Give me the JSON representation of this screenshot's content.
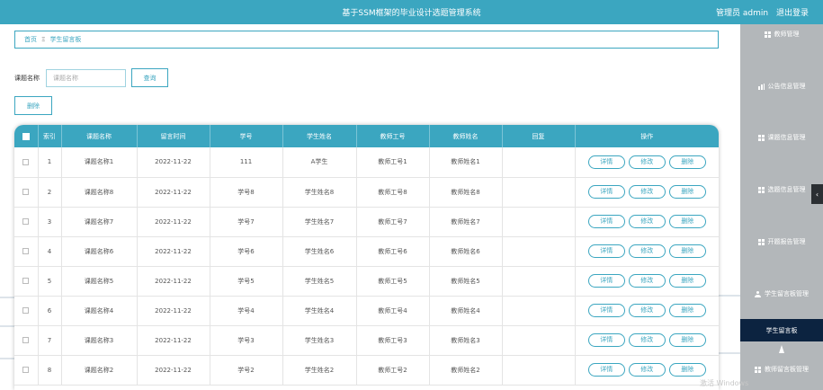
{
  "header": {
    "title": "基于SSM框架的毕业设计选题管理系统",
    "user_label": "管理员 admin",
    "logout_label": "退出登录"
  },
  "sidebar": {
    "items": [
      {
        "label": "教师管理",
        "icon": "grid-icon"
      },
      {
        "label": "公告信息管理",
        "icon": "bar-chart-icon"
      },
      {
        "label": "课题信息管理",
        "icon": "grid-icon"
      },
      {
        "label": "选题信息管理",
        "icon": "grid-icon"
      },
      {
        "label": "开题报告管理",
        "icon": "grid-icon"
      },
      {
        "label": "学生留言板管理",
        "icon": "user-icon"
      },
      {
        "label": "学生留言板",
        "icon": ""
      },
      {
        "label": "教师留言板管理",
        "icon": "grid-icon"
      }
    ],
    "collapse_glyph": "‹"
  },
  "breadcrumb": {
    "home": "首页",
    "separator": "Ξ",
    "current": "学生留言板"
  },
  "search": {
    "label": "课题名称",
    "placeholder": "课题名称",
    "button": "查询"
  },
  "toolbar": {
    "delete_label": "删除"
  },
  "table": {
    "columns": [
      "",
      "索引",
      "课题名称",
      "留言时间",
      "学号",
      "学生姓名",
      "教师工号",
      "教师姓名",
      "回复",
      "操作"
    ],
    "actions": [
      "详情",
      "修改",
      "删除"
    ],
    "rows": [
      {
        "index": "1",
        "topic": "课题名称1",
        "time": "2022-11-22",
        "sid": "111",
        "sname": "A学生",
        "tid": "教师工号1",
        "tname": "教师姓名1",
        "reply": ""
      },
      {
        "index": "2",
        "topic": "课题名称8",
        "time": "2022-11-22",
        "sid": "学号8",
        "sname": "学生姓名8",
        "tid": "教师工号8",
        "tname": "教师姓名8",
        "reply": ""
      },
      {
        "index": "3",
        "topic": "课题名称7",
        "time": "2022-11-22",
        "sid": "学号7",
        "sname": "学生姓名7",
        "tid": "教师工号7",
        "tname": "教师姓名7",
        "reply": ""
      },
      {
        "index": "4",
        "topic": "课题名称6",
        "time": "2022-11-22",
        "sid": "学号6",
        "sname": "学生姓名6",
        "tid": "教师工号6",
        "tname": "教师姓名6",
        "reply": ""
      },
      {
        "index": "5",
        "topic": "课题名称5",
        "time": "2022-11-22",
        "sid": "学号5",
        "sname": "学生姓名5",
        "tid": "教师工号5",
        "tname": "教师姓名5",
        "reply": ""
      },
      {
        "index": "6",
        "topic": "课题名称4",
        "time": "2022-11-22",
        "sid": "学号4",
        "sname": "学生姓名4",
        "tid": "教师工号4",
        "tname": "教师姓名4",
        "reply": ""
      },
      {
        "index": "7",
        "topic": "课题名称3",
        "time": "2022-11-22",
        "sid": "学号3",
        "sname": "学生姓名3",
        "tid": "教师工号3",
        "tname": "教师姓名3",
        "reply": ""
      },
      {
        "index": "8",
        "topic": "课题名称2",
        "time": "2022-11-22",
        "sid": "学号2",
        "sname": "学生姓名2",
        "tid": "教师工号2",
        "tname": "教师姓名2",
        "reply": ""
      }
    ]
  },
  "watermark": "激活 Windows",
  "colors": {
    "accent": "#3ba6c0",
    "sidebar_bg": "#b3b7ba",
    "sidebar_active": "#0c2340"
  }
}
